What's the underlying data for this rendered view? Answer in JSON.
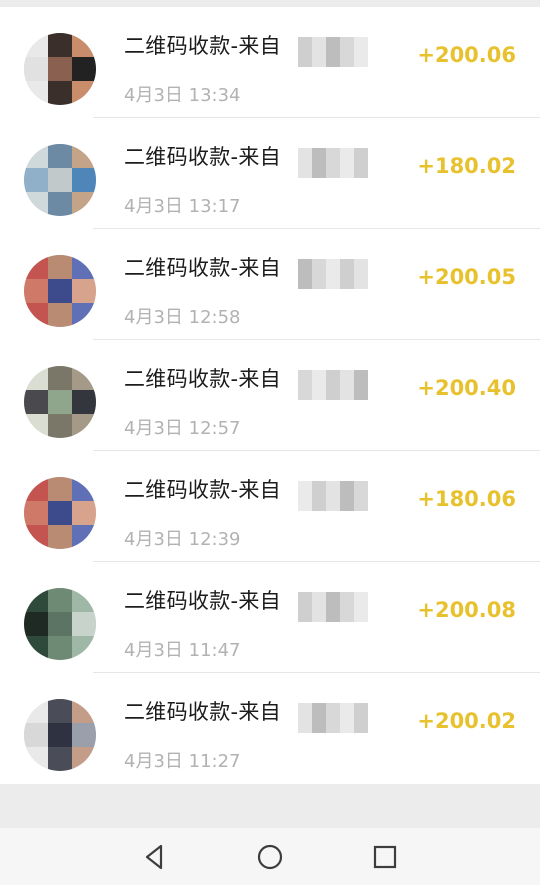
{
  "transactions": [
    {
      "title": "二维码收款-来自",
      "time": "4月3日 13:34",
      "amount": "+200.06",
      "avatar": [
        "#e9e9e9",
        "#3a2f2a",
        "#c98d6c",
        "#e1e1e1",
        "#8a6150",
        "#222"
      ]
    },
    {
      "title": "二维码收款-来自",
      "time": "4月3日 13:17",
      "amount": "+180.02",
      "avatar": [
        "#cfd8da",
        "#6c8aa3",
        "#c4a488",
        "#8fb0c8",
        "#c2c9ca",
        "#4f86b9"
      ]
    },
    {
      "title": "二维码收款-来自",
      "time": "4月3日 12:58",
      "amount": "+200.05",
      "avatar": [
        "#c45450",
        "#b98b72",
        "#5f70b6",
        "#cf7a68",
        "#3d4a8c",
        "#d7a38d"
      ]
    },
    {
      "title": "二维码收款-来自",
      "time": "4月3日 12:57",
      "amount": "+200.40",
      "avatar": [
        "#d9ddd2",
        "#7b7768",
        "#a59a87",
        "#4a4a4e",
        "#8fa58c",
        "#33363c"
      ]
    },
    {
      "title": "二维码收款-来自",
      "time": "4月3日 12:39",
      "amount": "+180.06",
      "avatar": [
        "#c45450",
        "#b98b72",
        "#5f70b6",
        "#cf7a68",
        "#3d4a8c",
        "#d7a38d"
      ]
    },
    {
      "title": "二维码收款-来自",
      "time": "4月3日 11:47",
      "amount": "+200.08",
      "avatar": [
        "#2f4a3a",
        "#6f8a74",
        "#9fb7a6",
        "#1f2a25",
        "#5c7464",
        "#c7d3cb"
      ]
    },
    {
      "title": "二维码收款-来自",
      "time": "4月3日 11:27",
      "amount": "+200.02",
      "avatar": [
        "#e9e9e9",
        "#4a4d57",
        "#c39d88",
        "#d8d8d8",
        "#2f3240",
        "#9aa0ab"
      ]
    }
  ],
  "nav": {
    "back_icon": "back-triangle-icon",
    "home_icon": "home-circle-icon",
    "recent_icon": "recents-square-icon"
  }
}
